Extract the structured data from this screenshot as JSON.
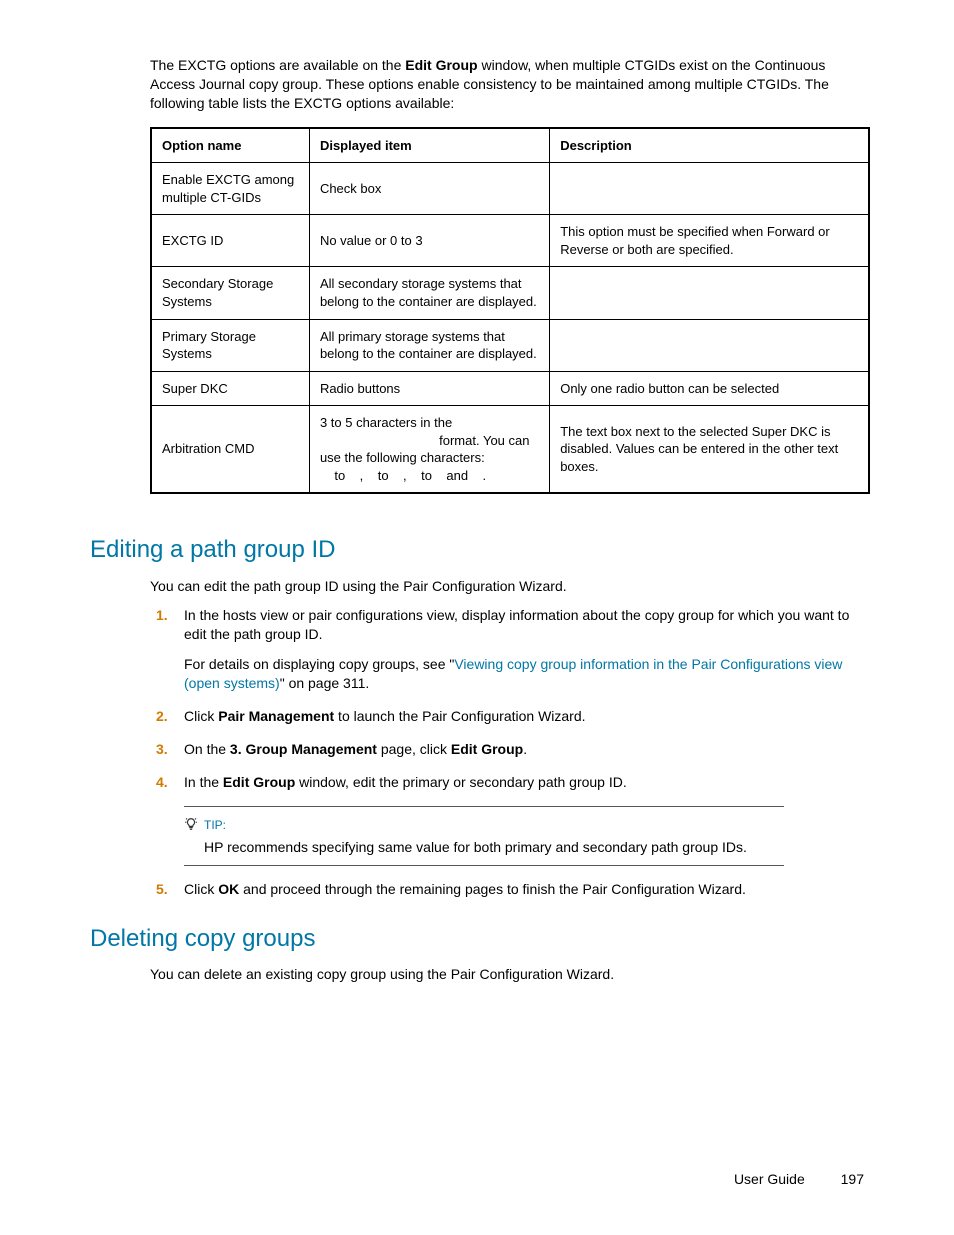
{
  "intro": {
    "pre": "The EXCTG options are available on the ",
    "bold": "Edit Group",
    "post": " window, when multiple CTGIDs exist on the Continuous Access Journal copy group. These options enable consistency to be maintained among multiple CTGIDs. The following table lists the EXCTG options available:"
  },
  "table": {
    "headers": [
      "Option name",
      "Displayed item",
      "Description"
    ],
    "rows": [
      {
        "name": "Enable EXCTG among multiple CT-GIDs",
        "item": "Check box",
        "desc": ""
      },
      {
        "name": "EXCTG ID",
        "item": "No value or 0 to 3",
        "desc": "This option must be specified when Forward or Reverse or both are specified."
      },
      {
        "name": "Secondary Storage Systems",
        "item": "All secondary storage systems that belong to the container are displayed.",
        "desc": ""
      },
      {
        "name": "Primary Storage Systems",
        "item": "All primary storage systems that belong to the container are displayed.",
        "desc": ""
      },
      {
        "name": "Super DKC",
        "item": "Radio buttons",
        "desc": "Only one radio button can be selected"
      },
      {
        "name": "Arbitration CMD",
        "item": "3 to 5 characters in the\n                                 format. You can use the following characters:\n    to    ,    to    ,    to    and    .",
        "desc": "The text box next to the selected Super DKC is disabled. Values can be entered in the other text boxes."
      }
    ]
  },
  "sections": {
    "edit": {
      "title": "Editing a path group ID",
      "lead": "You can edit the path group ID using the Pair Configuration Wizard.",
      "steps": {
        "s1": "In the hosts view or pair configurations view, display information about the copy group for which you want to edit the path group ID.",
        "s1_detail_pre": "For details on displaying copy groups, see \"",
        "s1_link": "Viewing copy group information in the Pair Configurations view (open systems)",
        "s1_detail_post": "\" on page 311.",
        "s2_pre": "Click ",
        "s2_b": "Pair Management",
        "s2_post": " to launch the Pair Configuration Wizard.",
        "s3_pre": "On the ",
        "s3_b1": "3. Group Management",
        "s3_mid": " page, click ",
        "s3_b2": "Edit Group",
        "s3_post": ".",
        "s4_pre": "In the ",
        "s4_b": "Edit Group",
        "s4_post": " window, edit the primary or secondary path group ID.",
        "tip_label": "TIP:",
        "tip_text": "HP recommends specifying same value for both primary and secondary path group IDs.",
        "s5_pre": "Click ",
        "s5_b": "OK",
        "s5_post": " and proceed through the remaining pages to finish the Pair Configuration Wizard."
      }
    },
    "delete": {
      "title": "Deleting copy groups",
      "lead": "You can delete an existing copy group using the Pair Configuration Wizard."
    }
  },
  "footer": {
    "label": "User Guide",
    "page": "197"
  }
}
